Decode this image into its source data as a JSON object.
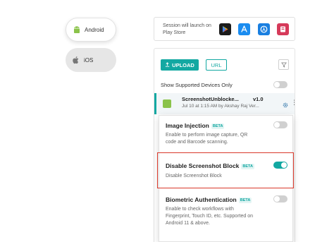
{
  "platforms": [
    {
      "label": "Android",
      "icon": "android-icon",
      "selected": true
    },
    {
      "label": "iOS",
      "icon": "apple-icon",
      "selected": false
    }
  ],
  "session_launch": {
    "text": "Session will launch on Play Store",
    "store_icons": [
      "play-store-icon",
      "app-store-icon",
      "testflight-icon",
      "app-center-icon"
    ]
  },
  "toolbar": {
    "upload_label": "UPLOAD",
    "url_label": "URL"
  },
  "show_supported_label": "Show Supported Devices Only",
  "app": {
    "name": "ScreenshotUnblocke...",
    "version": "v1.0",
    "meta": "Jul 10 at 1:15 AM by Akshay Raj Ver..."
  },
  "options": [
    {
      "title": "Image Injection",
      "badge": "BETA",
      "description": "Enable to perform image capture, QR code and Barcode scanning.",
      "enabled": false
    },
    {
      "title": "Disable Screenshot Block",
      "badge": "BETA",
      "description": "Disable Screenshot Block",
      "enabled": true
    },
    {
      "title": "Biometric Authentication",
      "badge": "BETA",
      "description": "Enable to check workflows with Fingerprint, Touch ID, etc. Supported on Android 11 & above.",
      "enabled": false
    }
  ],
  "colors": {
    "accent": "#13a8a2",
    "highlight": "#d9392b"
  }
}
